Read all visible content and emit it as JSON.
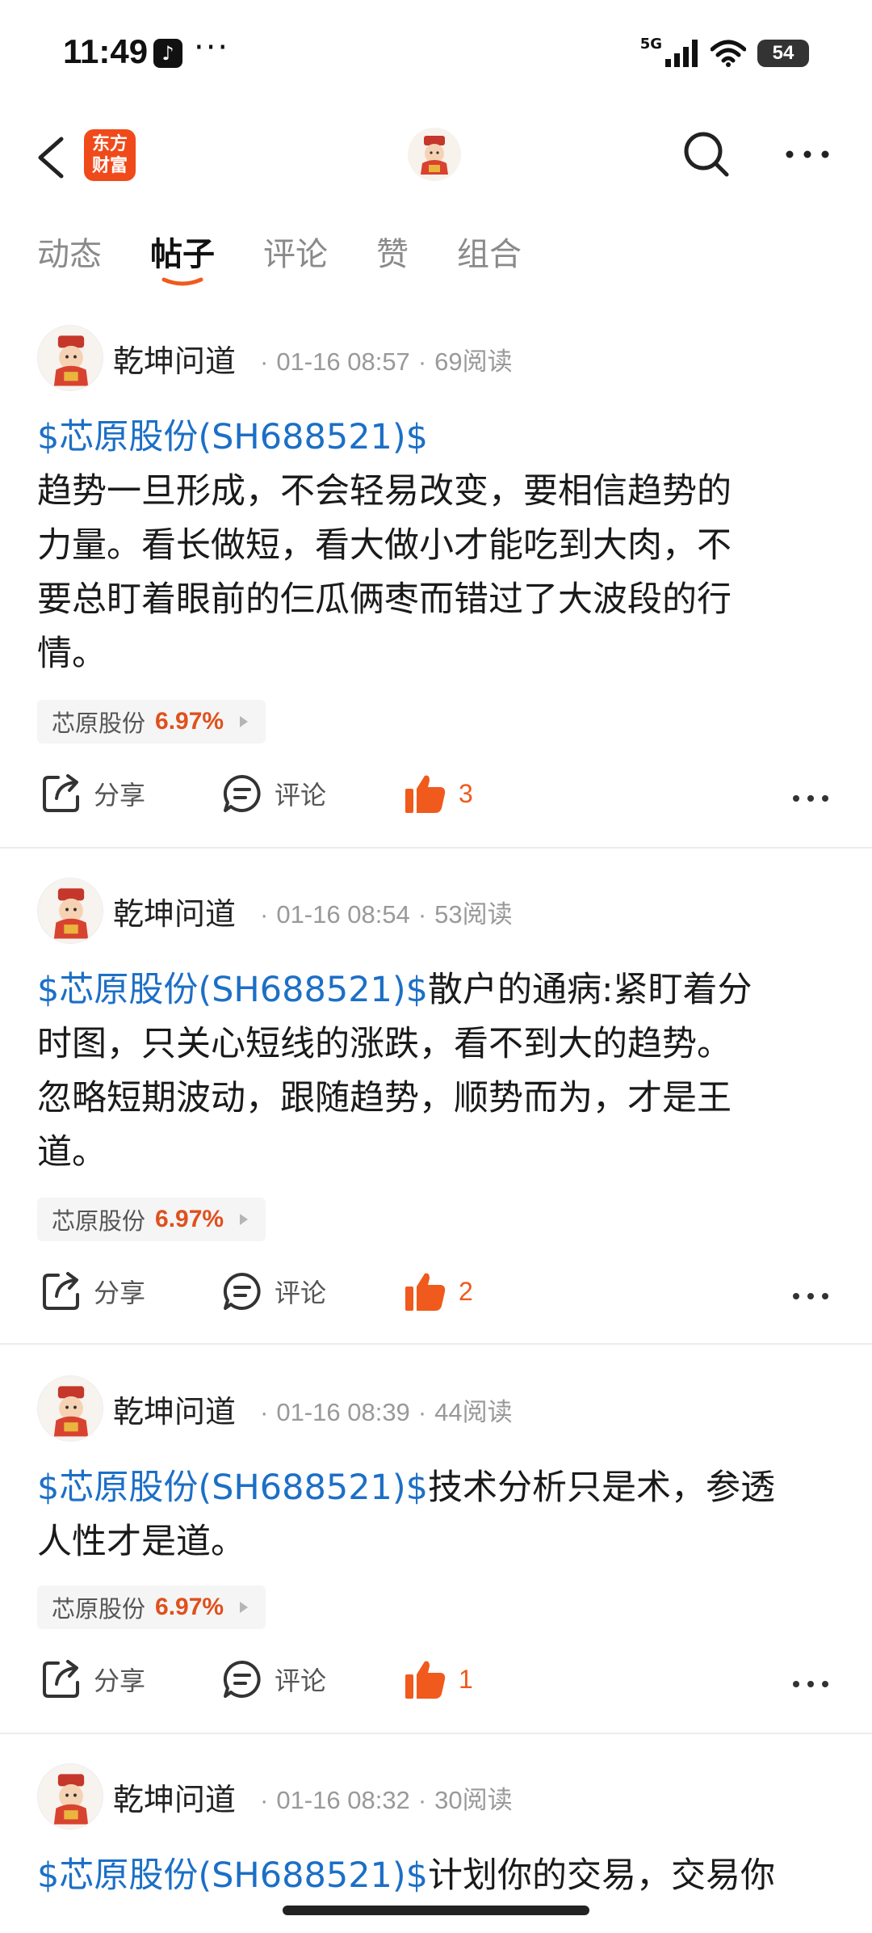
{
  "status_bar": {
    "time": "11:49",
    "dots": "···",
    "network": "5G",
    "battery": "54"
  },
  "nav": {
    "brand": "东方财富"
  },
  "tabs": [
    {
      "label": "动态",
      "active": false
    },
    {
      "label": "帖子",
      "active": true
    },
    {
      "label": "评论",
      "active": false
    },
    {
      "label": "赞",
      "active": false
    },
    {
      "label": "组合",
      "active": false
    }
  ],
  "colors": {
    "accent": "#f05a1c",
    "link": "#1c6fc6",
    "brand": "#f04a1a"
  },
  "posts": [
    {
      "author": "乾坤问道",
      "time": "01-16 08:57",
      "reads": "69阅读",
      "stock_link": "$芯原股份(SH688521)$",
      "text_after_link": "",
      "text_lines": [
        "趋势一旦形成，不会轻易改变，要相信趋势的",
        "力量。看长做短，看大做小才能吃到大肉，不",
        "要总盯着眼前的仨瓜俩枣而错过了大波段的行",
        "情。"
      ],
      "chip_name": "芯原股份",
      "chip_pct": "6.97%",
      "share": "分享",
      "comment": "评论",
      "likes": "3"
    },
    {
      "author": "乾坤问道",
      "time": "01-16 08:54",
      "reads": "53阅读",
      "stock_link": "$芯原股份(SH688521)$",
      "text_after_link": "散户的通病:紧盯着分",
      "text_lines": [
        "时图，只关心短线的涨跌，看不到大的趋势。",
        "忽略短期波动，跟随趋势，顺势而为，才是王",
        "道。"
      ],
      "chip_name": "芯原股份",
      "chip_pct": "6.97%",
      "share": "分享",
      "comment": "评论",
      "likes": "2"
    },
    {
      "author": "乾坤问道",
      "time": "01-16 08:39",
      "reads": "44阅读",
      "stock_link": "$芯原股份(SH688521)$",
      "text_after_link": "技术分析只是术，参透",
      "text_lines": [
        "人性才是道。"
      ],
      "chip_name": "芯原股份",
      "chip_pct": "6.97%",
      "share": "分享",
      "comment": "评论",
      "likes": "1"
    },
    {
      "author": "乾坤问道",
      "time": "01-16 08:32",
      "reads": "30阅读",
      "stock_link": "$芯原股份(SH688521)$",
      "text_after_link": "计划你的交易，交易你",
      "text_lines": []
    }
  ]
}
